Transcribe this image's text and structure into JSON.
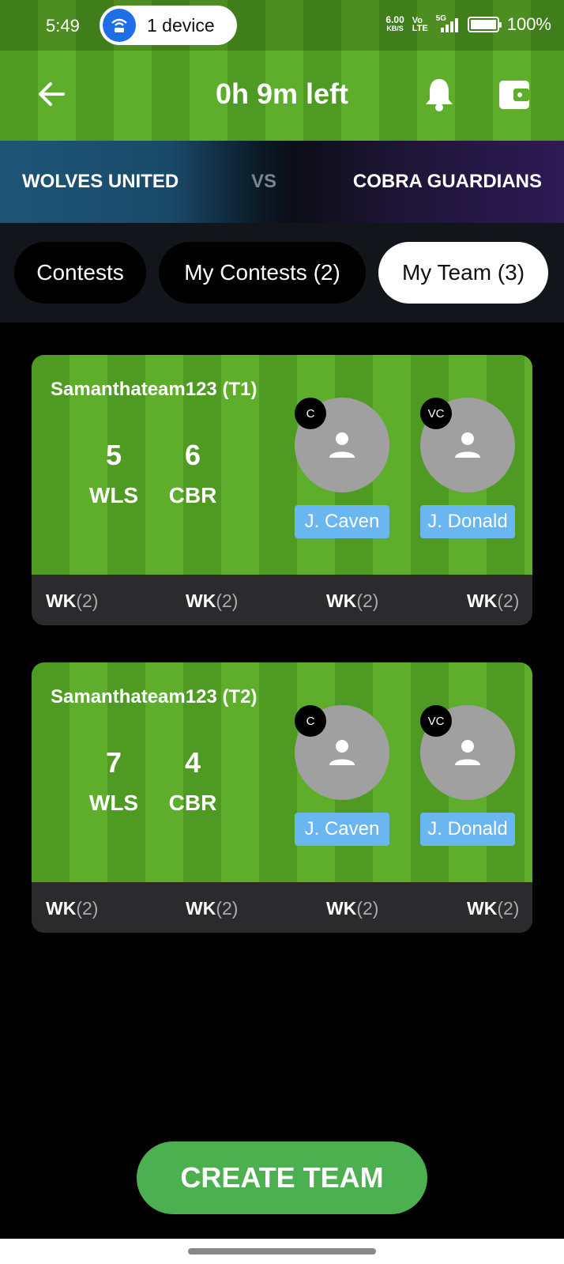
{
  "status_bar": {
    "time": "5:49",
    "hotspot_label": "1 device",
    "speed_top": "6.00",
    "speed_unit": "KB/S",
    "volte_top": "Vo",
    "volte_bottom": "LTE",
    "network": "5G",
    "battery": "100%"
  },
  "header": {
    "title": "0h 9m left"
  },
  "match": {
    "team_left": "WOLVES UNITED",
    "vs": "VS",
    "team_right": "COBRA GUARDIANS"
  },
  "tabs": [
    {
      "label": "Contests",
      "active": false
    },
    {
      "label": "My Contests (2)",
      "active": false
    },
    {
      "label": "My Team (3)",
      "active": true
    }
  ],
  "teams": [
    {
      "name": "Samanthateam123 (T1)",
      "left_count": "5",
      "left_abbr": "WLS",
      "right_count": "6",
      "right_abbr": "CBR",
      "captain": {
        "badge": "C",
        "name": "J. Caven"
      },
      "vice_captain": {
        "badge": "VC",
        "name": "J. Donald"
      },
      "roles": [
        {
          "role": "WK",
          "count": "(2)"
        },
        {
          "role": "WK",
          "count": "(2)"
        },
        {
          "role": "WK",
          "count": "(2)"
        },
        {
          "role": "WK",
          "count": "(2)"
        }
      ]
    },
    {
      "name": "Samanthateam123 (T2)",
      "left_count": "7",
      "left_abbr": "WLS",
      "right_count": "4",
      "right_abbr": "CBR",
      "captain": {
        "badge": "C",
        "name": "J. Caven"
      },
      "vice_captain": {
        "badge": "VC",
        "name": "J. Donald"
      },
      "roles": [
        {
          "role": "WK",
          "count": "(2)"
        },
        {
          "role": "WK",
          "count": "(2)"
        },
        {
          "role": "WK",
          "count": "(2)"
        },
        {
          "role": "WK",
          "count": "(2)"
        }
      ]
    }
  ],
  "create_button": "CREATE TEAM",
  "colors": {
    "field_dark": "#4e9a22",
    "field_light": "#5fae2b",
    "create_button": "#4caf50",
    "player_name_bg": "#6ab6f0"
  }
}
